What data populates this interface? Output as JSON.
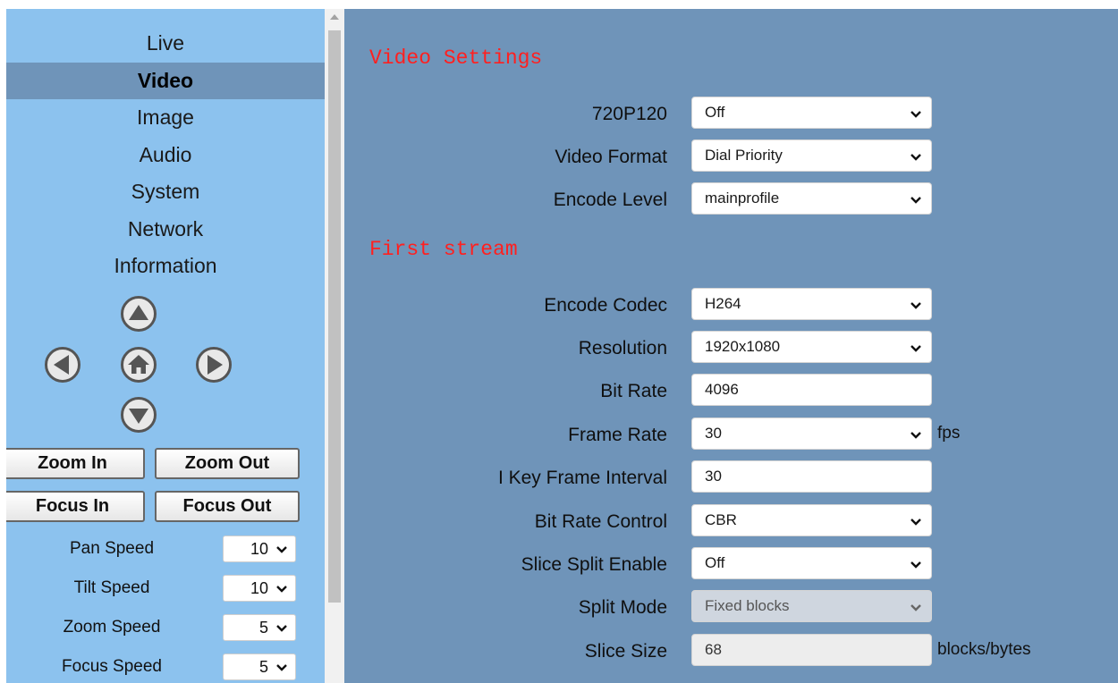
{
  "sidebar": {
    "menu": [
      "Live",
      "Video",
      "Image",
      "Audio",
      "System",
      "Network",
      "Information"
    ],
    "active": "Video",
    "buttons": {
      "zoom_in": "Zoom In",
      "zoom_out": "Zoom Out",
      "focus_in": "Focus In",
      "focus_out": "Focus Out"
    },
    "speeds": [
      {
        "label": "Pan Speed",
        "value": "10"
      },
      {
        "label": "Tilt Speed",
        "value": "10"
      },
      {
        "label": "Zoom Speed",
        "value": "5"
      },
      {
        "label": "Focus Speed",
        "value": "5"
      }
    ]
  },
  "main": {
    "video_settings_title": "Video Settings",
    "first_stream_title": "First stream",
    "video_settings": [
      {
        "label": "720P120",
        "value": "Off",
        "type": "select"
      },
      {
        "label": "Video Format",
        "value": "Dial Priority",
        "type": "select"
      },
      {
        "label": "Encode Level",
        "value": "mainprofile",
        "type": "select"
      }
    ],
    "first_stream": [
      {
        "label": "Encode Codec",
        "value": "H264",
        "type": "select"
      },
      {
        "label": "Resolution",
        "value": "1920x1080",
        "type": "select"
      },
      {
        "label": "Bit Rate",
        "value": "4096",
        "type": "input"
      },
      {
        "label": "Frame Rate",
        "value": "30",
        "type": "select",
        "suffix": "fps"
      },
      {
        "label": "I Key Frame Interval",
        "value": "30",
        "type": "input"
      },
      {
        "label": "Bit Rate Control",
        "value": "CBR",
        "type": "select"
      },
      {
        "label": "Slice Split Enable",
        "value": "Off",
        "type": "select"
      },
      {
        "label": "Split Mode",
        "value": "Fixed blocks",
        "type": "select",
        "disabled": true
      },
      {
        "label": "Slice Size",
        "value": "68",
        "type": "input",
        "readonly": true,
        "suffix": "blocks/bytes"
      }
    ]
  },
  "colors": {
    "sidebar_bg": "#8cc2ee",
    "active_item_bg": "#6f94b9",
    "main_bg": "#6f94b9",
    "section_title": "#ff2020"
  },
  "icons": [
    "arrow-up-icon",
    "arrow-left-icon",
    "home-icon",
    "arrow-right-icon",
    "arrow-down-icon",
    "chevron-down-icon"
  ]
}
